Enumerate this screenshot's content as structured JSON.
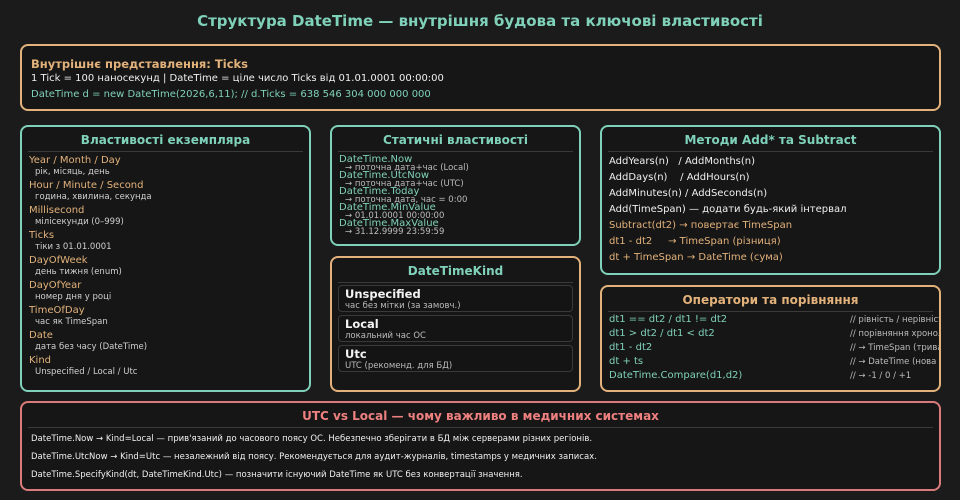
{
  "title": "Структура DateTime — внутрішня будова та ключові властивості",
  "ticks": {
    "heading": "Внутрішнє представлення: Ticks",
    "line1": "1 Tick = 100 наносекунд  |  DateTime = ціле число Ticks від 01.01.0001 00:00:00",
    "line2": "DateTime d = new DateTime(2026,6,11);  //  d.Ticks = 638 546 304 000 000 000"
  },
  "instance": {
    "heading": "Властивості екземпляра",
    "props": [
      {
        "name": "Year / Month / Day",
        "desc": "рік, місяць, день"
      },
      {
        "name": "Hour / Minute / Second",
        "desc": "година, хвилина, секунда"
      },
      {
        "name": "Millisecond",
        "desc": "мілісекунди (0–999)"
      },
      {
        "name": "Ticks",
        "desc": "тіки з 01.01.0001"
      },
      {
        "name": "DayOfWeek",
        "desc": "день тижня (enum)"
      },
      {
        "name": "DayOfYear",
        "desc": "номер дня у році"
      },
      {
        "name": "TimeOfDay",
        "desc": "час як TimeSpan"
      },
      {
        "name": "Date",
        "desc": "дата без часу (DateTime)"
      },
      {
        "name": "Kind",
        "desc": "Unspecified / Local / Utc"
      }
    ]
  },
  "static": {
    "heading": "Статичні властивості",
    "props": [
      {
        "name": "DateTime.Now",
        "desc": "→ поточна дата+час (Local)"
      },
      {
        "name": "DateTime.UtcNow",
        "desc": "→ поточна дата+час (UTC)"
      },
      {
        "name": "DateTime.Today",
        "desc": "→ поточна дата, час = 0:00"
      },
      {
        "name": "DateTime.MinValue",
        "desc": "→ 01.01.0001 00:00:00"
      },
      {
        "name": "DateTime.MaxValue",
        "desc": "→ 31.12.9999 23:59:59"
      }
    ]
  },
  "kind": {
    "heading": "DateTimeKind",
    "items": [
      {
        "name": "Unspecified",
        "desc": "час без мітки (за замовч.)"
      },
      {
        "name": "Local",
        "desc": "локальний час ОС"
      },
      {
        "name": "Utc",
        "desc": "UTC (рекоменд. для БД)"
      }
    ]
  },
  "add": {
    "heading": "Методи Add* та Subtract",
    "lines": [
      "AddYears(n)   / AddMonths(n)",
      "AddDays(n)    / AddHours(n)",
      "AddMinutes(n) / AddSeconds(n)",
      "Add(TimeSpan) — додати будь-який інтервал",
      "Subtract(dt2) → повертає TimeSpan",
      "dt1 - dt2     → TimeSpan (різниця)",
      "dt + TimeSpan → DateTime (сума)"
    ]
  },
  "ops": {
    "heading": "Оператори та порівняння",
    "rows": [
      {
        "expr": "dt1 == dt2 / dt1 != dt2",
        "comment": "// рівність / нерівність"
      },
      {
        "expr": "dt1 > dt2  / dt1 < dt2",
        "comment": "// порівняння хронологічно"
      },
      {
        "expr": "dt1 - dt2",
        "comment": "// → TimeSpan (тривалість)"
      },
      {
        "expr": "dt + ts",
        "comment": "// → DateTime (нова точка)"
      },
      {
        "expr": "DateTime.Compare(d1,d2)",
        "comment": "// → -1 / 0 / +1"
      }
    ]
  },
  "utc": {
    "heading": "UTC vs Local — чому важливо в медичних системах",
    "lines": [
      "DateTime.Now    → Kind=Local  — прив'язаний до часового поясу ОС. Небезпечно зберігати в БД між серверами різних регіонів.",
      "DateTime.UtcNow → Kind=Utc    — незалежний від поясу. Рекомендується для аудит-журналів, timestamps у медичних записах.",
      "DateTime.SpecifyKind(dt, DateTimeKind.Utc) — позначити існуючий DateTime як UTC без конвертації значення."
    ]
  },
  "colors": {
    "accent": "#7fd1b9",
    "orange": "#e3b27b",
    "red": "#d97b7b",
    "background": "#1b1b1b"
  }
}
